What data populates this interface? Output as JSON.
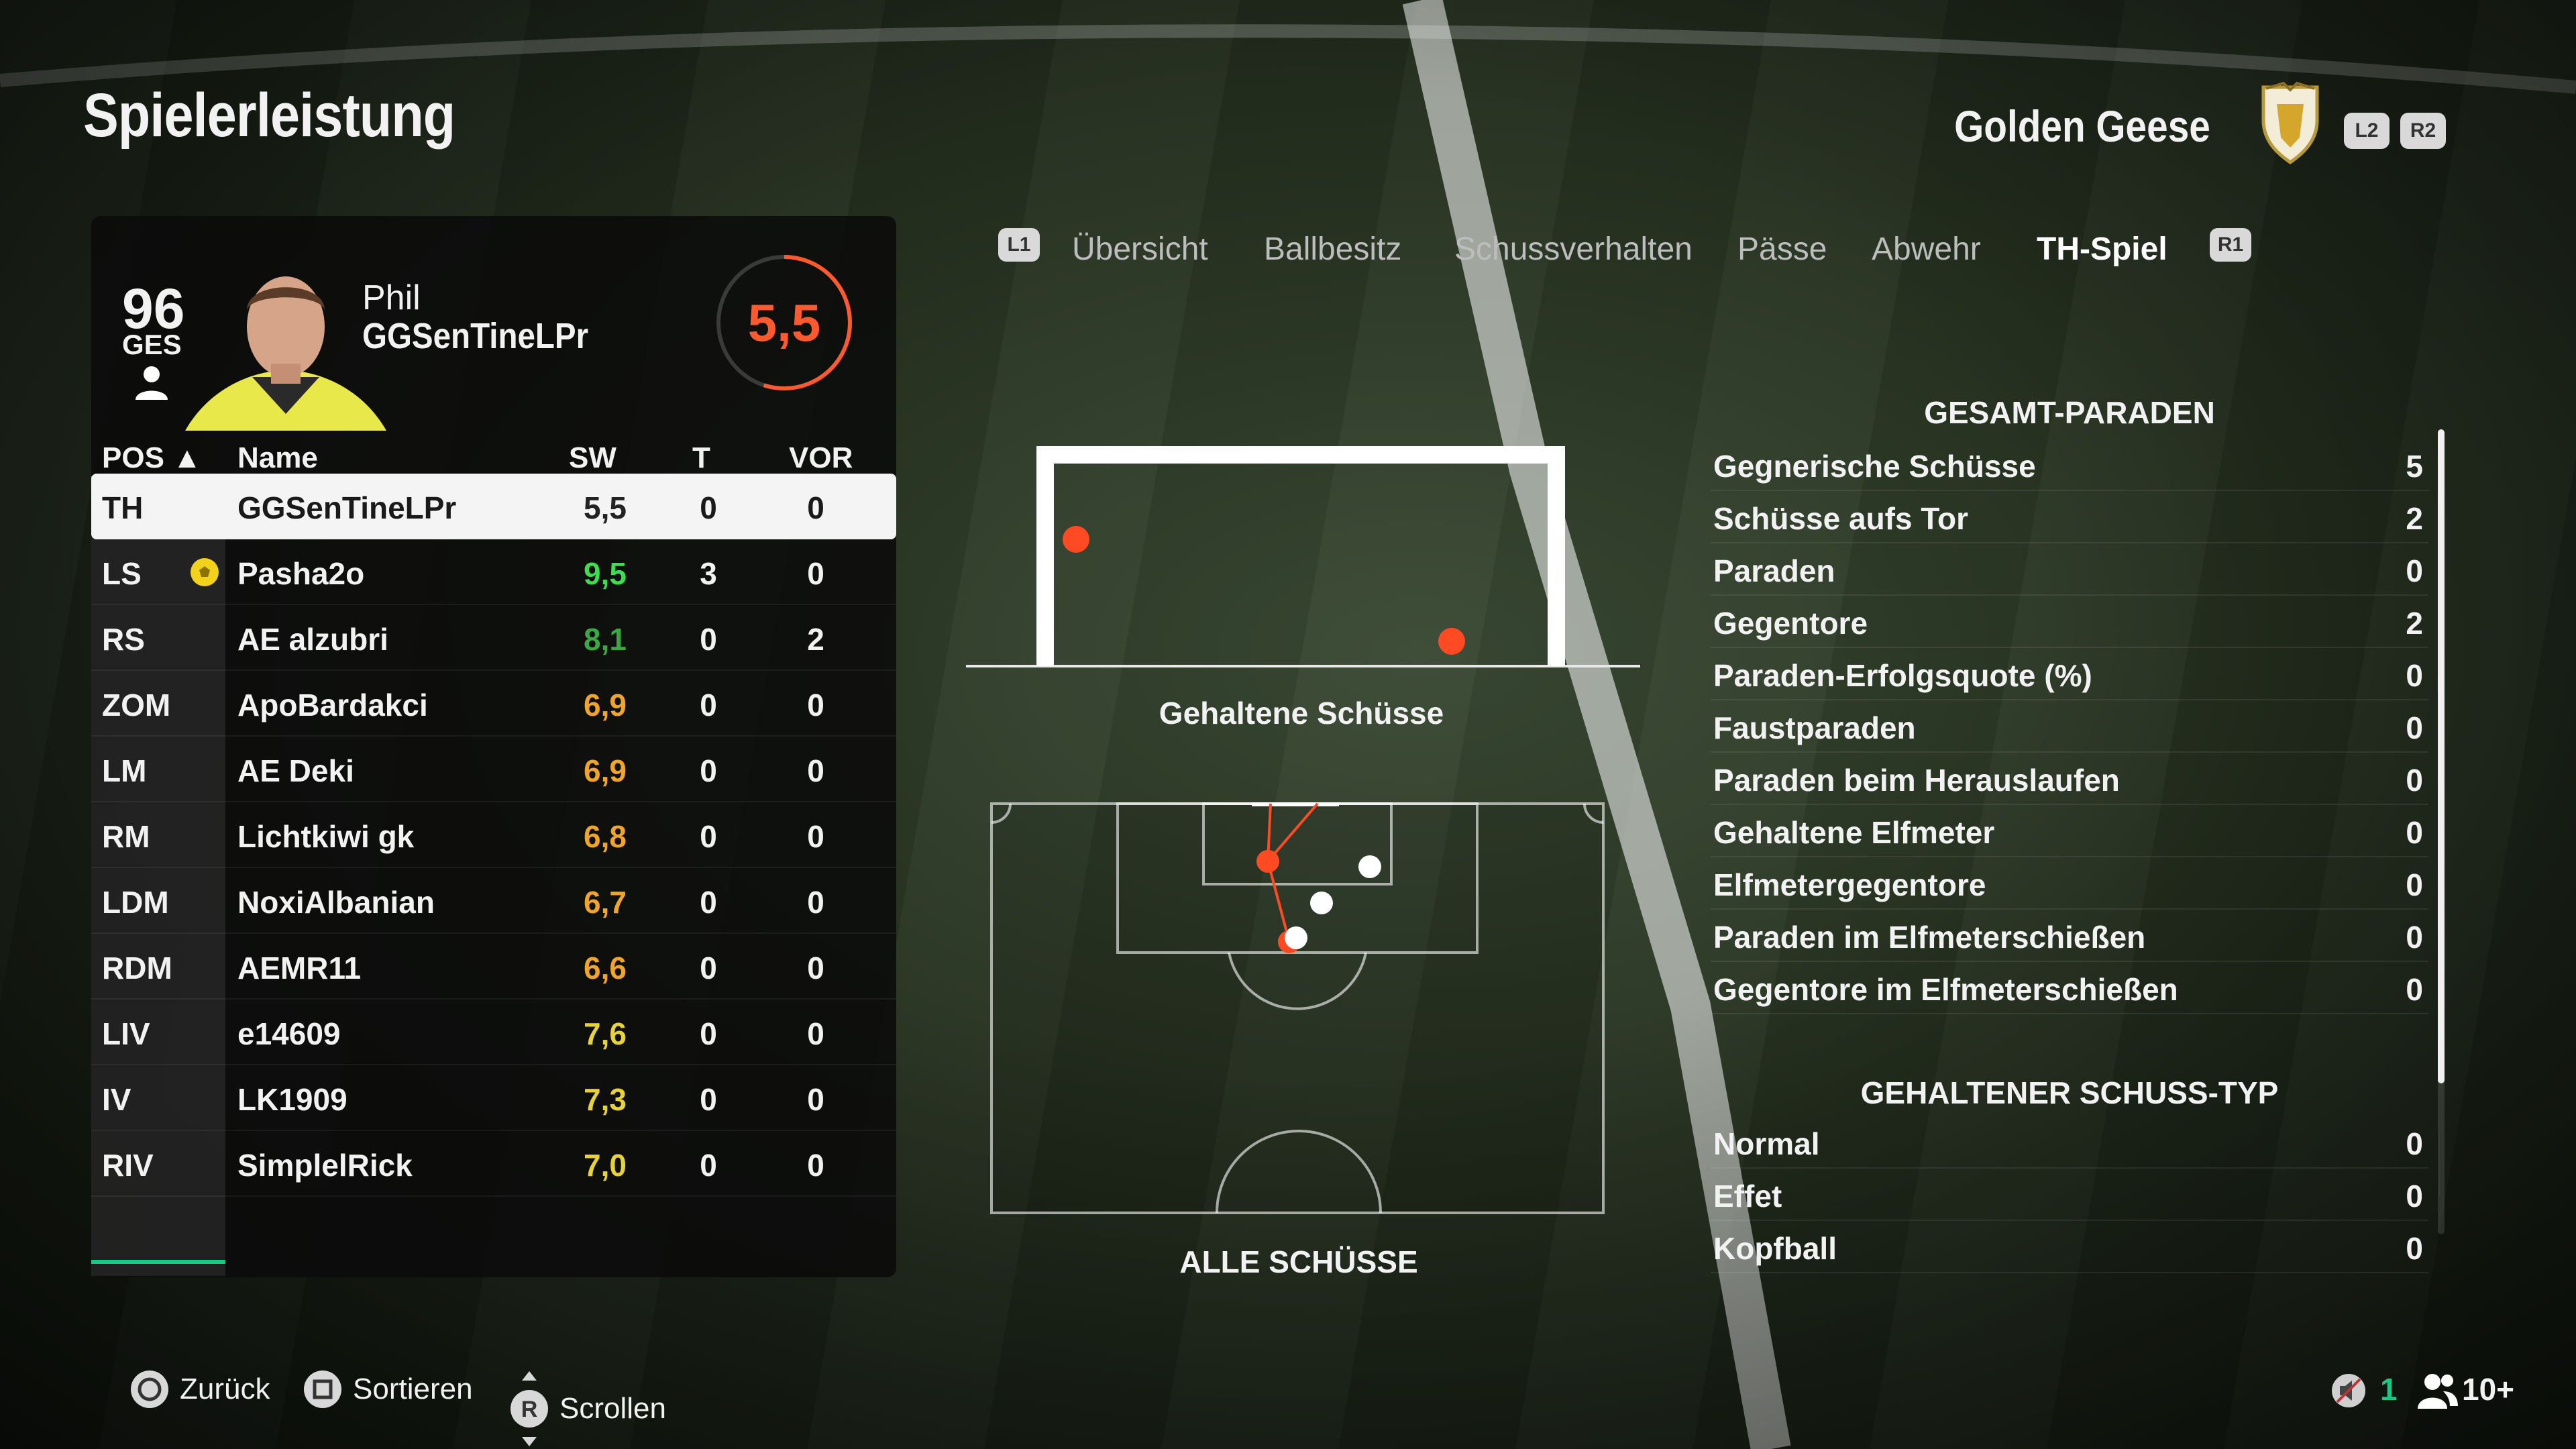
{
  "header": {
    "title": "Spielerleistung",
    "team_name": "Golden Geese",
    "left_trigger": "L2",
    "right_trigger": "R2"
  },
  "player": {
    "overall": "96",
    "overall_label": "GES",
    "first_name": "Phil",
    "last_name": "GGSenTineLPr",
    "rating": "5,5",
    "rating_fraction": 0.55
  },
  "table": {
    "columns": [
      "POS ▲",
      "Name",
      "SW",
      "T",
      "VOR"
    ],
    "rows": [
      {
        "pos": "TH",
        "name": "GGSenTineLPr",
        "sw": "5,5",
        "t": "0",
        "vor": "0",
        "sw_color": "#222222"
      },
      {
        "pos": "LS",
        "name": "Pasha2o",
        "sw": "9,5",
        "t": "3",
        "vor": "0",
        "sw_color": "#3ddc52",
        "motm": true
      },
      {
        "pos": "RS",
        "name": "AE alzubri",
        "sw": "8,1",
        "t": "0",
        "vor": "2",
        "sw_color": "#3aa843"
      },
      {
        "pos": "ZOM",
        "name": "ApoBardakci",
        "sw": "6,9",
        "t": "0",
        "vor": "0",
        "sw_color": "#f0a52a"
      },
      {
        "pos": "LM",
        "name": "AE Deki",
        "sw": "6,9",
        "t": "0",
        "vor": "0",
        "sw_color": "#f0a52a"
      },
      {
        "pos": "RM",
        "name": "Lichtkiwi gk",
        "sw": "6,8",
        "t": "0",
        "vor": "0",
        "sw_color": "#f0a52a"
      },
      {
        "pos": "LDM",
        "name": "NoxiAlbanian",
        "sw": "6,7",
        "t": "0",
        "vor": "0",
        "sw_color": "#f0a52a"
      },
      {
        "pos": "RDM",
        "name": "AEMR11",
        "sw": "6,6",
        "t": "0",
        "vor": "0",
        "sw_color": "#f0a52a"
      },
      {
        "pos": "LIV",
        "name": "e14609",
        "sw": "7,6",
        "t": "0",
        "vor": "0",
        "sw_color": "#e8d23a"
      },
      {
        "pos": "IV",
        "name": "LK1909",
        "sw": "7,3",
        "t": "0",
        "vor": "0",
        "sw_color": "#e8d23a"
      },
      {
        "pos": "RIV",
        "name": "SimplelRick",
        "sw": "7,0",
        "t": "0",
        "vor": "0",
        "sw_color": "#e8d23a"
      }
    ]
  },
  "tabs": {
    "left_bumper": "L1",
    "right_bumper": "R1",
    "items": [
      {
        "label": "Übersicht",
        "active": false
      },
      {
        "label": "Ballbesitz",
        "active": false
      },
      {
        "label": "Schussverhalten",
        "active": false
      },
      {
        "label": "Pässe",
        "active": false
      },
      {
        "label": "Abwehr",
        "active": false
      },
      {
        "label": "TH-Spiel",
        "active": true
      }
    ]
  },
  "diagrams": {
    "goal_caption": "Gehaltene Schüsse",
    "pitch_caption": "ALLE SCHÜSSE"
  },
  "stats": {
    "saves_title": "GESAMT-PARADEN",
    "saves": [
      {
        "label": "Gegnerische Schüsse",
        "value": "5"
      },
      {
        "label": "Schüsse aufs Tor",
        "value": "2"
      },
      {
        "label": "Paraden",
        "value": "0"
      },
      {
        "label": "Gegentore",
        "value": "2"
      },
      {
        "label": "Paraden-Erfolgsquote (%)",
        "value": "0"
      },
      {
        "label": "Faustparaden",
        "value": "0"
      },
      {
        "label": "Paraden beim Herauslaufen",
        "value": "0"
      },
      {
        "label": "Gehaltene Elfmeter",
        "value": "0"
      },
      {
        "label": "Elfmetergegentore",
        "value": "0"
      },
      {
        "label": "Paraden im Elfmeterschießen",
        "value": "0"
      },
      {
        "label": "Gegentore im Elfmeterschießen",
        "value": "0"
      }
    ],
    "types_title": "GEHALTENER SCHUSS-TYP",
    "types": [
      {
        "label": "Normal",
        "value": "0"
      },
      {
        "label": "Effet",
        "value": "0"
      },
      {
        "label": "Kopfball",
        "value": "0"
      }
    ]
  },
  "footer": {
    "back_label": "Zurück",
    "sort_label": "Sortieren",
    "scroll_label": "Scrollen",
    "scroll_button": "R",
    "mic_count": "1",
    "players_count": "10+"
  },
  "colors": {
    "accent_green": "#16c985",
    "rating_orange": "#ff5a2e",
    "goal_red": "#ff4a24"
  },
  "icons": [
    "circle-button-icon",
    "square-button-icon",
    "right-stick-icon",
    "microphone-muted-icon",
    "group-icon",
    "person-icon",
    "ball-icon",
    "crest-icon"
  ]
}
